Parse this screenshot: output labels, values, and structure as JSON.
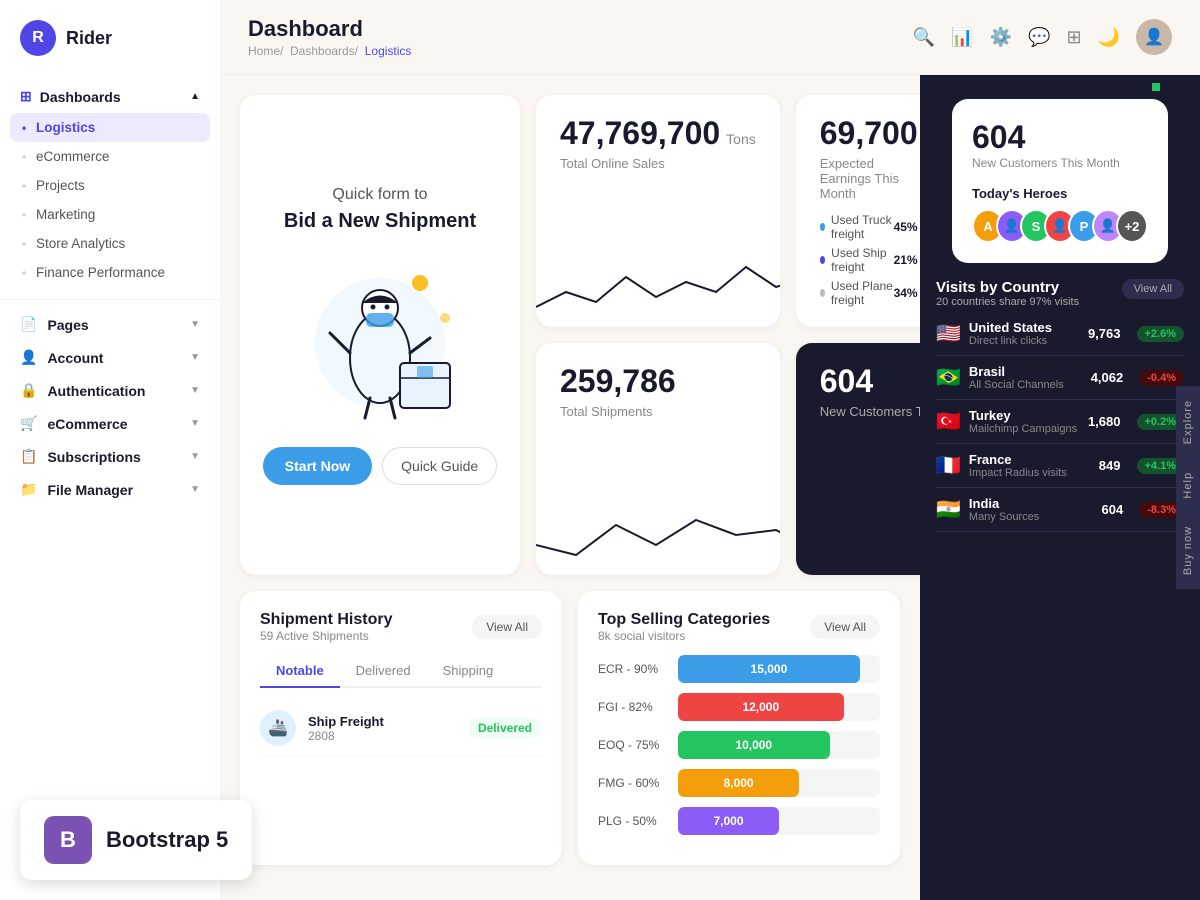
{
  "app": {
    "name": "Rider",
    "logo_letter": "R"
  },
  "sidebar": {
    "dashboards_label": "Dashboards",
    "items": [
      {
        "label": "Logistics",
        "active": true
      },
      {
        "label": "eCommerce",
        "active": false
      },
      {
        "label": "Projects",
        "active": false
      },
      {
        "label": "Marketing",
        "active": false
      },
      {
        "label": "Store Analytics",
        "active": false
      },
      {
        "label": "Finance Performance",
        "active": false
      }
    ],
    "pages_label": "Pages",
    "account_label": "Account",
    "authentication_label": "Authentication",
    "ecommerce_label": "eCommerce",
    "subscriptions_label": "Subscriptions",
    "file_manager_label": "File Manager"
  },
  "header": {
    "title": "Dashboard",
    "breadcrumb": [
      "Home",
      "Dashboards",
      "Logistics"
    ]
  },
  "quick_form": {
    "title": "Quick form to",
    "subtitle": "Bid a New Shipment",
    "start_now": "Start Now",
    "quick_guide": "Quick Guide"
  },
  "stats": {
    "online_sales_value": "47,769,700",
    "online_sales_unit": "Tons",
    "online_sales_label": "Total Online Sales",
    "shipments_value": "259,786",
    "shipments_label": "Total Shipments",
    "earnings_value": "69,700",
    "earnings_label": "Expected Earnings This Month",
    "customers_value": "604",
    "customers_label": "New Customers This Month",
    "freight_items": [
      {
        "label": "Used Truck freight",
        "pct": "45%",
        "color": "#3b9de8"
      },
      {
        "label": "Used Ship freight",
        "pct": "21%",
        "color": "#4f46e5"
      },
      {
        "label": "Used Plane freight",
        "pct": "34%",
        "color": "#e5e7eb"
      }
    ]
  },
  "shipment_history": {
    "title": "Shipment History",
    "subtitle": "59 Active Shipments",
    "view_all": "View All",
    "tabs": [
      "Notable",
      "Delivered",
      "Shipping"
    ],
    "items": [
      {
        "name": "Ship Freight",
        "id": "2808",
        "status": "Delivered",
        "status_type": "delivered"
      }
    ]
  },
  "categories": {
    "title": "Top Selling Categories",
    "subtitle": "8k social visitors",
    "view_all": "View All",
    "items": [
      {
        "label": "ECR - 90%",
        "value": "15,000",
        "color": "#3b9de8",
        "width": "90%"
      },
      {
        "label": "FGI - 82%",
        "value": "12,000",
        "color": "#ef4444",
        "width": "82%"
      },
      {
        "label": "EOQ - 75%",
        "value": "10,000",
        "color": "#22c55e",
        "width": "75%"
      },
      {
        "label": "FMG - 60%",
        "value": "8,000",
        "color": "#f59e0b",
        "width": "60%"
      },
      {
        "label": "PLG - 50%",
        "value": "7,000",
        "color": "#8b5cf6",
        "width": "50%"
      }
    ]
  },
  "visits_by_country": {
    "title": "Visits by Country",
    "subtitle": "20 countries share 97% visits",
    "view_all": "View All",
    "countries": [
      {
        "flag": "🇺🇸",
        "name": "United States",
        "source": "Direct link clicks",
        "visits": "9,763",
        "change": "+2.6%",
        "up": true
      },
      {
        "flag": "🇧🇷",
        "name": "Brasil",
        "source": "All Social Channels",
        "visits": "4,062",
        "change": "-0.4%",
        "up": false
      },
      {
        "flag": "🇹🇷",
        "name": "Turkey",
        "source": "Mailchimp Campaigns",
        "visits": "1,680",
        "change": "+0.2%",
        "up": true
      },
      {
        "flag": "🇫🇷",
        "name": "France",
        "source": "Impact Radius visits",
        "visits": "849",
        "change": "+4.1%",
        "up": true
      },
      {
        "flag": "🇮🇳",
        "name": "India",
        "source": "Many Sources",
        "visits": "604",
        "change": "-8.3%",
        "up": false
      }
    ]
  },
  "heroes": {
    "title": "Today's Heroes",
    "avatars": [
      {
        "letter": "A",
        "color": "#f59e0b"
      },
      {
        "letter": "",
        "color": "#8b5cf6",
        "img": true
      },
      {
        "letter": "S",
        "color": "#22c55e"
      },
      {
        "letter": "",
        "color": "#ef4444",
        "img": true
      },
      {
        "letter": "P",
        "color": "#3b9de8"
      },
      {
        "letter": "",
        "color": "#c084fc",
        "img": true
      },
      {
        "letter": "+2",
        "color": "#555"
      }
    ]
  },
  "side_tabs": [
    "Explore",
    "Help",
    "Buy now"
  ],
  "bootstrap": {
    "label": "Bootstrap 5"
  }
}
